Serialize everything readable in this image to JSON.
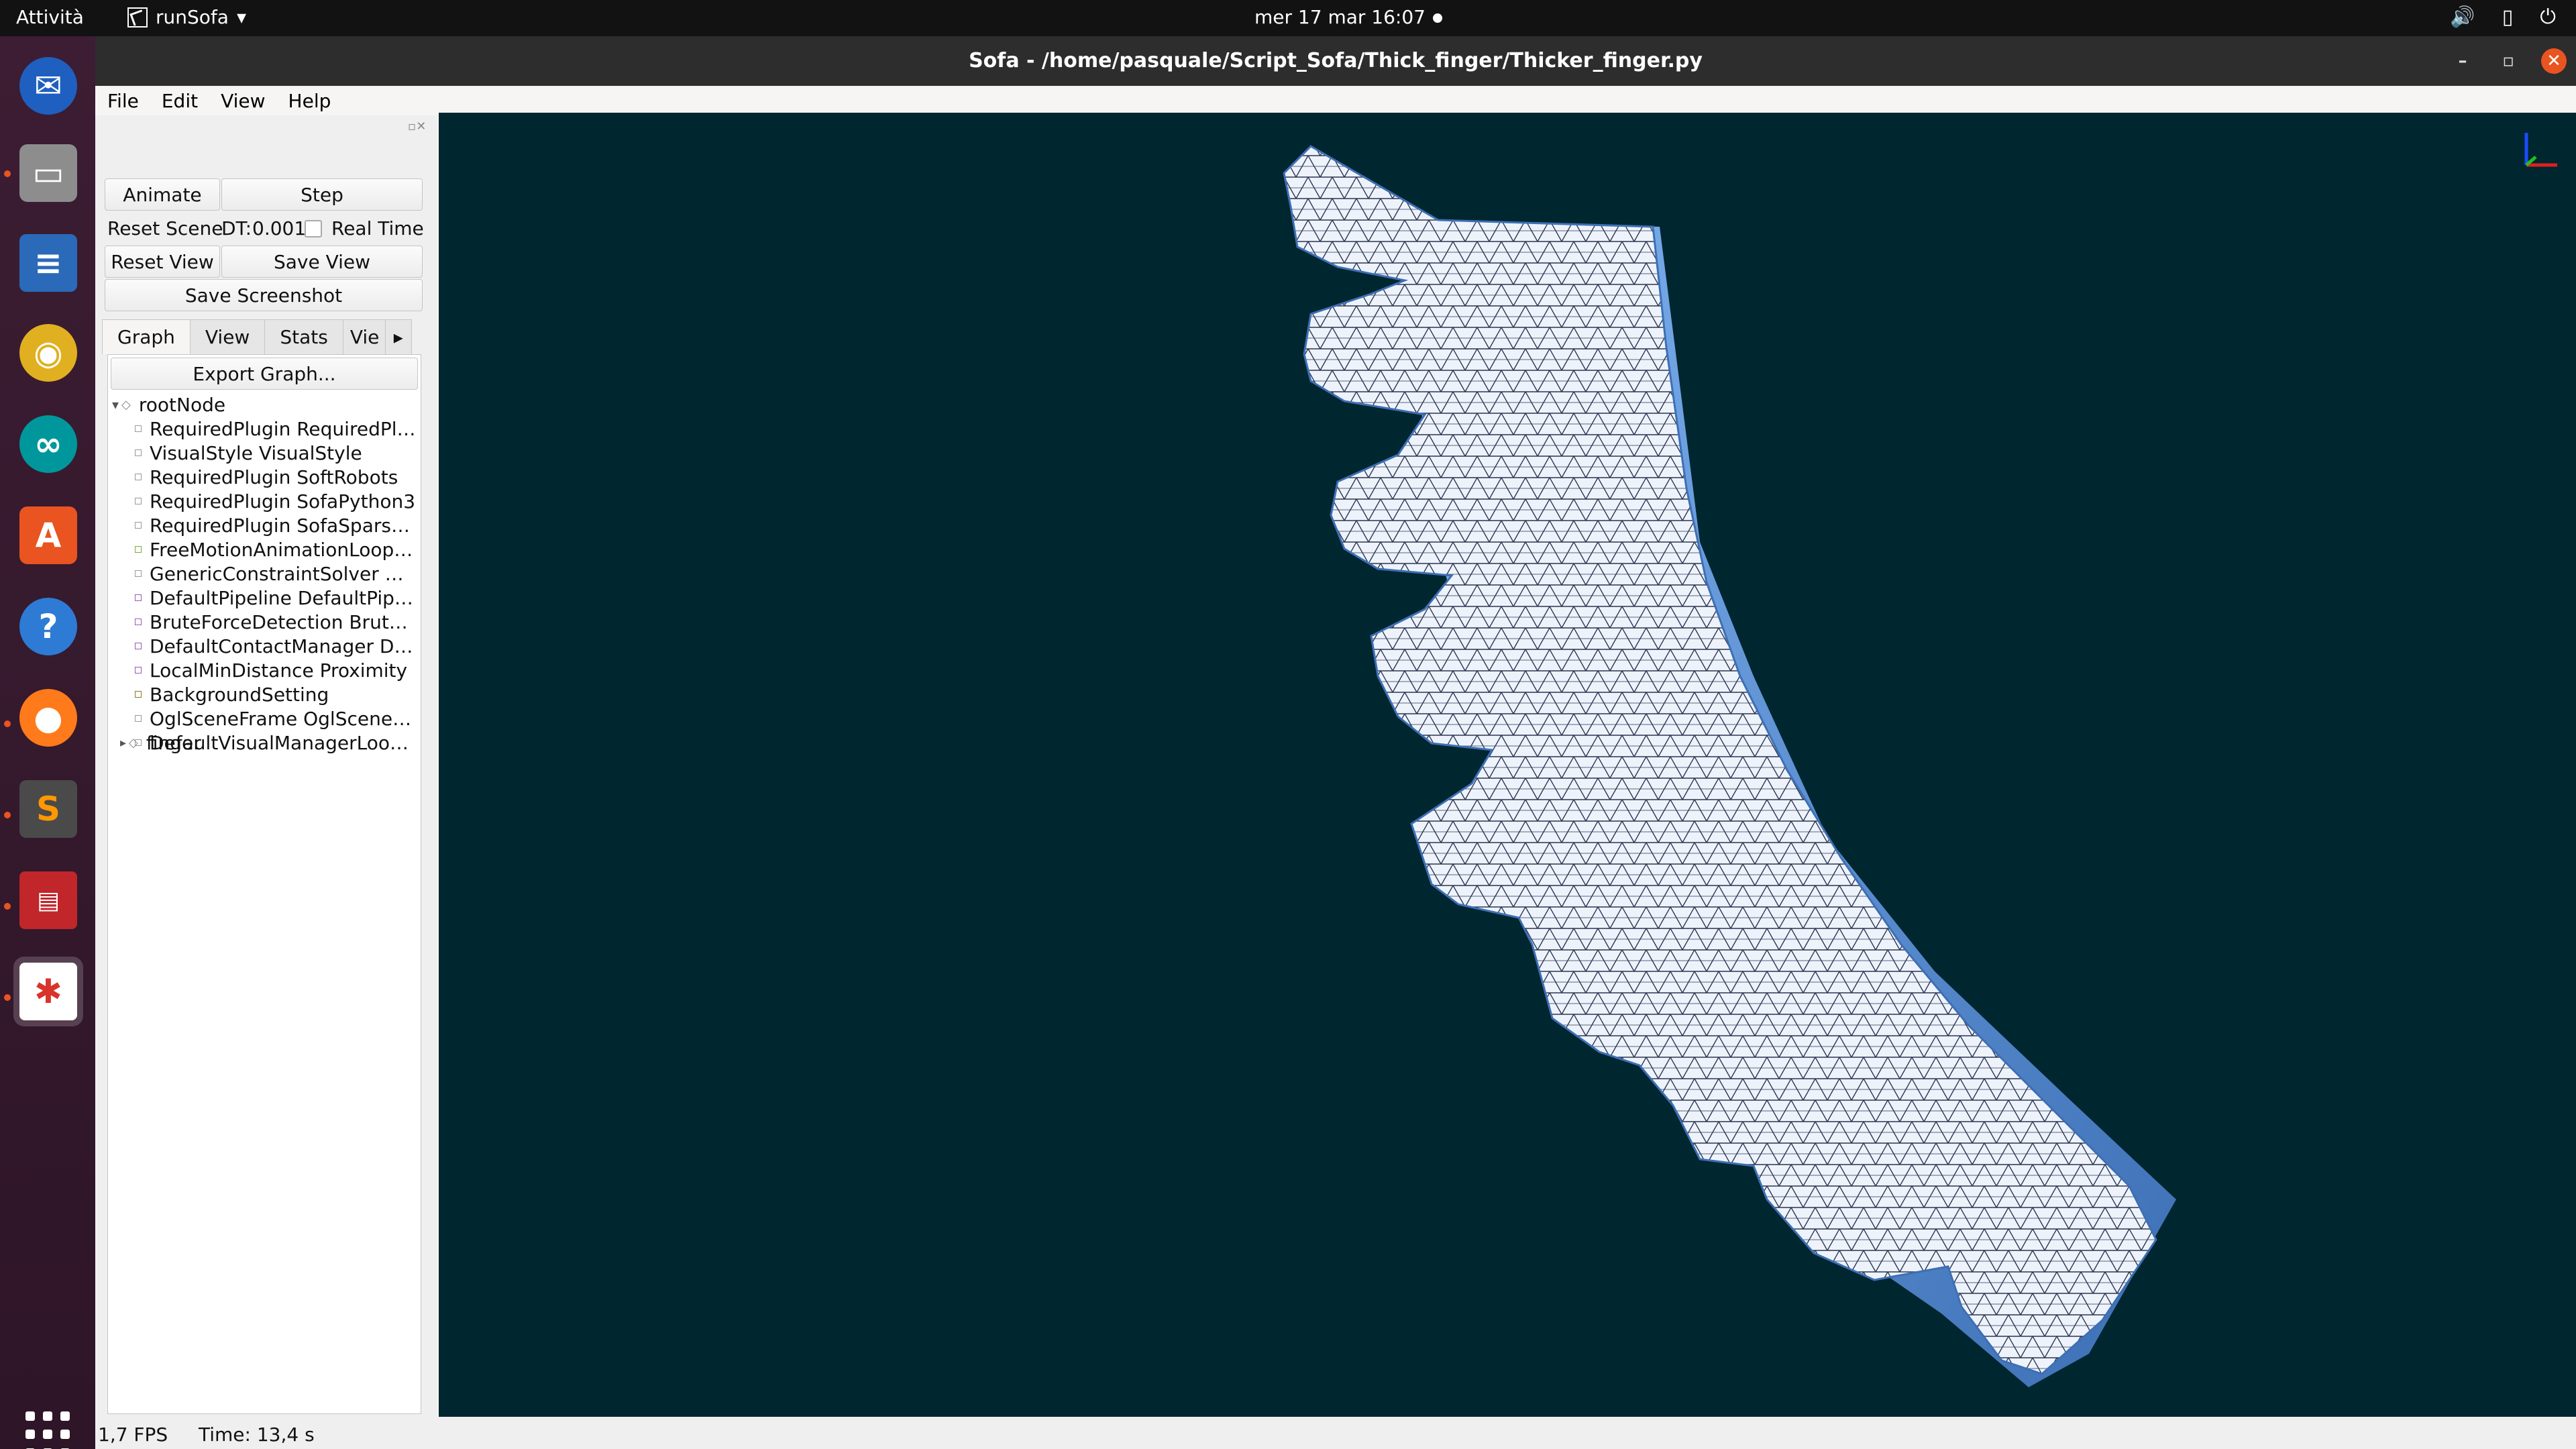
{
  "topbar": {
    "activities": "Attività",
    "app_name": "runSofa",
    "clock": "mer 17 mar  16:07"
  },
  "window": {
    "title": "Sofa - /home/pasquale/Script_Sofa/Thick_finger/Thicker_finger.py"
  },
  "menu": [
    "File",
    "Edit",
    "View",
    "Help"
  ],
  "controls": {
    "animate": "Animate",
    "step": "Step",
    "reset_scene": "Reset Scene",
    "dt_label": "DT:",
    "dt_value": "0.001",
    "real_time": "Real Time",
    "reset_view": "Reset View",
    "save_view": "Save View",
    "save_screenshot": "Save Screenshot"
  },
  "tabs": [
    "Graph",
    "View",
    "Stats",
    "Vie"
  ],
  "graph": {
    "export": "Export Graph...",
    "root": "rootNode",
    "items": [
      {
        "label": "RequiredPlugin RequiredPlu...",
        "color": "#9a9a9a"
      },
      {
        "label": "VisualStyle VisualStyle",
        "color": "#9a9a9a"
      },
      {
        "label": "RequiredPlugin SoftRobots",
        "color": "#9a9a9a"
      },
      {
        "label": "RequiredPlugin SofaPython3",
        "color": "#9a9a9a"
      },
      {
        "label": "RequiredPlugin SofaSparseS...",
        "color": "#9a9a9a"
      },
      {
        "label": "FreeMotionAnimationLoop ...",
        "color": "#7caa3a"
      },
      {
        "label": "GenericConstraintSolver Ge...",
        "color": "#9a9a9a"
      },
      {
        "label": "DefaultPipeline DefaultPipe...",
        "color": "#9b59b6"
      },
      {
        "label": "BruteForceDetection Brute...",
        "color": "#9b59b6"
      },
      {
        "label": "DefaultContactManager De...",
        "color": "#9b59b6"
      },
      {
        "label": "LocalMinDistance Proximity",
        "color": "#9b59b6"
      },
      {
        "label": "BackgroundSetting",
        "color": "#8a7a2a"
      },
      {
        "label": "OglSceneFrame OglSceneFr...",
        "color": "#9a9a9a"
      },
      {
        "label": "DefaultVisualManagerLoop ...",
        "color": "#9a9a9a"
      }
    ],
    "child": "finger"
  },
  "status": {
    "fps": "1,7 FPS",
    "time": "Time: 13,4 s"
  },
  "colors": {
    "viewport_bg": "#00262f",
    "mesh_light": "#eef3fb",
    "mesh_side": "#5b8fd6",
    "ubuntu_orange": "#e95420"
  }
}
